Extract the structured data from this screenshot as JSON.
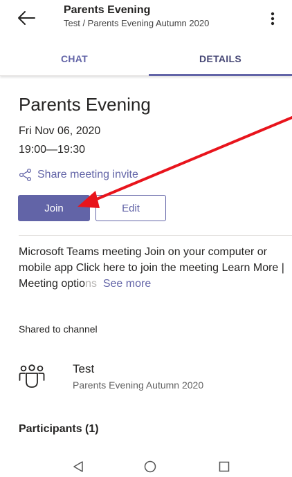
{
  "header": {
    "title": "Parents Evening",
    "subtitle": "Test / Parents Evening Autumn 2020",
    "back_icon": "arrow-left-icon",
    "more_icon": "more-vertical-icon"
  },
  "tabs": [
    {
      "label": "CHAT",
      "selected": false
    },
    {
      "label": "DETAILS",
      "selected": true
    }
  ],
  "meeting": {
    "title": "Parents Evening",
    "date": "Fri Nov 06, 2020",
    "time": "19:00—19:30",
    "share_label": "Share meeting invite",
    "join_label": "Join",
    "edit_label": "Edit",
    "description_main": "Microsoft Teams meeting Join on your computer or mobile app Click here to join the meeting Learn More | Meeting optio",
    "description_faded": "ns",
    "see_more_label": "See more"
  },
  "shared": {
    "label": "Shared to channel",
    "channel_name": "Test",
    "channel_desc": "Parents Evening Autumn 2020",
    "icon": "team-icon"
  },
  "participants": {
    "label": "Participants (1)"
  },
  "colors": {
    "accent": "#6264a7",
    "annotation": "#e8141c"
  }
}
